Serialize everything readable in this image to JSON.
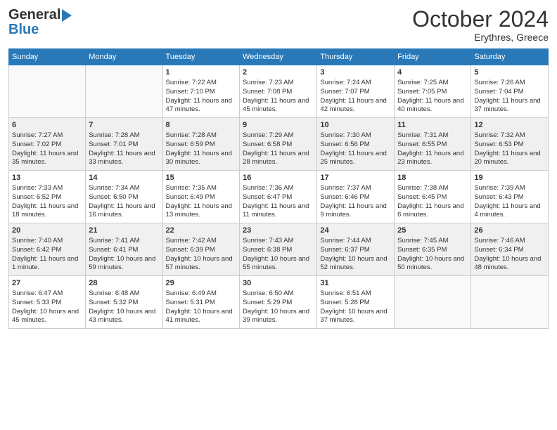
{
  "header": {
    "logo_general": "General",
    "logo_blue": "Blue",
    "month_title": "October 2024",
    "location": "Erythres, Greece"
  },
  "days_of_week": [
    "Sunday",
    "Monday",
    "Tuesday",
    "Wednesday",
    "Thursday",
    "Friday",
    "Saturday"
  ],
  "weeks": [
    [
      {
        "day": "",
        "sunrise": "",
        "sunset": "",
        "daylight": ""
      },
      {
        "day": "",
        "sunrise": "",
        "sunset": "",
        "daylight": ""
      },
      {
        "day": "1",
        "sunrise": "Sunrise: 7:22 AM",
        "sunset": "Sunset: 7:10 PM",
        "daylight": "Daylight: 11 hours and 47 minutes."
      },
      {
        "day": "2",
        "sunrise": "Sunrise: 7:23 AM",
        "sunset": "Sunset: 7:08 PM",
        "daylight": "Daylight: 11 hours and 45 minutes."
      },
      {
        "day": "3",
        "sunrise": "Sunrise: 7:24 AM",
        "sunset": "Sunset: 7:07 PM",
        "daylight": "Daylight: 11 hours and 42 minutes."
      },
      {
        "day": "4",
        "sunrise": "Sunrise: 7:25 AM",
        "sunset": "Sunset: 7:05 PM",
        "daylight": "Daylight: 11 hours and 40 minutes."
      },
      {
        "day": "5",
        "sunrise": "Sunrise: 7:26 AM",
        "sunset": "Sunset: 7:04 PM",
        "daylight": "Daylight: 11 hours and 37 minutes."
      }
    ],
    [
      {
        "day": "6",
        "sunrise": "Sunrise: 7:27 AM",
        "sunset": "Sunset: 7:02 PM",
        "daylight": "Daylight: 11 hours and 35 minutes."
      },
      {
        "day": "7",
        "sunrise": "Sunrise: 7:28 AM",
        "sunset": "Sunset: 7:01 PM",
        "daylight": "Daylight: 11 hours and 33 minutes."
      },
      {
        "day": "8",
        "sunrise": "Sunrise: 7:28 AM",
        "sunset": "Sunset: 6:59 PM",
        "daylight": "Daylight: 11 hours and 30 minutes."
      },
      {
        "day": "9",
        "sunrise": "Sunrise: 7:29 AM",
        "sunset": "Sunset: 6:58 PM",
        "daylight": "Daylight: 11 hours and 28 minutes."
      },
      {
        "day": "10",
        "sunrise": "Sunrise: 7:30 AM",
        "sunset": "Sunset: 6:56 PM",
        "daylight": "Daylight: 11 hours and 25 minutes."
      },
      {
        "day": "11",
        "sunrise": "Sunrise: 7:31 AM",
        "sunset": "Sunset: 6:55 PM",
        "daylight": "Daylight: 11 hours and 23 minutes."
      },
      {
        "day": "12",
        "sunrise": "Sunrise: 7:32 AM",
        "sunset": "Sunset: 6:53 PM",
        "daylight": "Daylight: 11 hours and 20 minutes."
      }
    ],
    [
      {
        "day": "13",
        "sunrise": "Sunrise: 7:33 AM",
        "sunset": "Sunset: 6:52 PM",
        "daylight": "Daylight: 11 hours and 18 minutes."
      },
      {
        "day": "14",
        "sunrise": "Sunrise: 7:34 AM",
        "sunset": "Sunset: 6:50 PM",
        "daylight": "Daylight: 11 hours and 16 minutes."
      },
      {
        "day": "15",
        "sunrise": "Sunrise: 7:35 AM",
        "sunset": "Sunset: 6:49 PM",
        "daylight": "Daylight: 11 hours and 13 minutes."
      },
      {
        "day": "16",
        "sunrise": "Sunrise: 7:36 AM",
        "sunset": "Sunset: 6:47 PM",
        "daylight": "Daylight: 11 hours and 11 minutes."
      },
      {
        "day": "17",
        "sunrise": "Sunrise: 7:37 AM",
        "sunset": "Sunset: 6:46 PM",
        "daylight": "Daylight: 11 hours and 9 minutes."
      },
      {
        "day": "18",
        "sunrise": "Sunrise: 7:38 AM",
        "sunset": "Sunset: 6:45 PM",
        "daylight": "Daylight: 11 hours and 6 minutes."
      },
      {
        "day": "19",
        "sunrise": "Sunrise: 7:39 AM",
        "sunset": "Sunset: 6:43 PM",
        "daylight": "Daylight: 11 hours and 4 minutes."
      }
    ],
    [
      {
        "day": "20",
        "sunrise": "Sunrise: 7:40 AM",
        "sunset": "Sunset: 6:42 PM",
        "daylight": "Daylight: 11 hours and 1 minute."
      },
      {
        "day": "21",
        "sunrise": "Sunrise: 7:41 AM",
        "sunset": "Sunset: 6:41 PM",
        "daylight": "Daylight: 10 hours and 59 minutes."
      },
      {
        "day": "22",
        "sunrise": "Sunrise: 7:42 AM",
        "sunset": "Sunset: 6:39 PM",
        "daylight": "Daylight: 10 hours and 57 minutes."
      },
      {
        "day": "23",
        "sunrise": "Sunrise: 7:43 AM",
        "sunset": "Sunset: 6:38 PM",
        "daylight": "Daylight: 10 hours and 55 minutes."
      },
      {
        "day": "24",
        "sunrise": "Sunrise: 7:44 AM",
        "sunset": "Sunset: 6:37 PM",
        "daylight": "Daylight: 10 hours and 52 minutes."
      },
      {
        "day": "25",
        "sunrise": "Sunrise: 7:45 AM",
        "sunset": "Sunset: 6:35 PM",
        "daylight": "Daylight: 10 hours and 50 minutes."
      },
      {
        "day": "26",
        "sunrise": "Sunrise: 7:46 AM",
        "sunset": "Sunset: 6:34 PM",
        "daylight": "Daylight: 10 hours and 48 minutes."
      }
    ],
    [
      {
        "day": "27",
        "sunrise": "Sunrise: 6:47 AM",
        "sunset": "Sunset: 5:33 PM",
        "daylight": "Daylight: 10 hours and 45 minutes."
      },
      {
        "day": "28",
        "sunrise": "Sunrise: 6:48 AM",
        "sunset": "Sunset: 5:32 PM",
        "daylight": "Daylight: 10 hours and 43 minutes."
      },
      {
        "day": "29",
        "sunrise": "Sunrise: 6:49 AM",
        "sunset": "Sunset: 5:31 PM",
        "daylight": "Daylight: 10 hours and 41 minutes."
      },
      {
        "day": "30",
        "sunrise": "Sunrise: 6:50 AM",
        "sunset": "Sunset: 5:29 PM",
        "daylight": "Daylight: 10 hours and 39 minutes."
      },
      {
        "day": "31",
        "sunrise": "Sunrise: 6:51 AM",
        "sunset": "Sunset: 5:28 PM",
        "daylight": "Daylight: 10 hours and 37 minutes."
      },
      {
        "day": "",
        "sunrise": "",
        "sunset": "",
        "daylight": ""
      },
      {
        "day": "",
        "sunrise": "",
        "sunset": "",
        "daylight": ""
      }
    ]
  ]
}
